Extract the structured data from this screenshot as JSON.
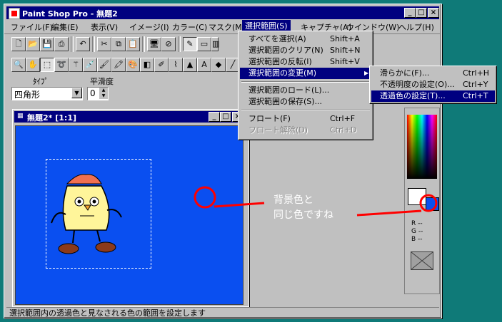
{
  "app": {
    "title": "Paint Shop Pro - 無題2"
  },
  "menubar": [
    "ファイル(F)",
    "編集(E)",
    "表示(V)",
    "イメージ(I)",
    "カラー(C)",
    "マスク(M)",
    "選択範囲(S)",
    "キャプチャ(A)",
    "ウインドウ(W)",
    "ヘルプ(H)"
  ],
  "menu_selection": {
    "items": [
      {
        "label": "すべてを選択(A)",
        "shortcut": "Shift+A"
      },
      {
        "label": "選択範囲のクリア(N)",
        "shortcut": "Shift+N"
      },
      {
        "label": "選択範囲の反転(I)",
        "shortcut": "Shift+V"
      },
      {
        "label": "選択範囲の変更(M)",
        "shortcut": ""
      },
      {
        "label": "選択範囲のロード(L)...",
        "shortcut": ""
      },
      {
        "label": "選択範囲の保存(S)...",
        "shortcut": ""
      },
      {
        "label": "フロート(F)",
        "shortcut": "Ctrl+F"
      },
      {
        "label": "フロート解除(D)",
        "shortcut": "Ctrl+D"
      }
    ]
  },
  "submenu_modify": {
    "items": [
      {
        "label": "滑らかに(F)...",
        "shortcut": "Ctrl+H"
      },
      {
        "label": "不透明度の設定(O)...",
        "shortcut": "Ctrl+Y"
      },
      {
        "label": "透過色の設定(T)...",
        "shortcut": "Ctrl+T"
      }
    ]
  },
  "options": {
    "type_label": "ﾀｲﾌﾟ",
    "type_value": "四角形",
    "smooth_label": "平滑度",
    "smooth_value": "0"
  },
  "doc": {
    "title": "無題2* [1:1]"
  },
  "annotation": {
    "line1": "背景色と",
    "line2": "同じ色ですね"
  },
  "palette": {
    "r": "R --",
    "g": "G --",
    "b": "B --"
  },
  "status": {
    "text": "選択範囲内の透過色と見なされる色の範囲を設定します"
  },
  "colors": {
    "canvas_bg": "#0a4ff0",
    "desktop": "#0f7a78",
    "titlebar": "#000080",
    "annotation": "#ff0000"
  }
}
